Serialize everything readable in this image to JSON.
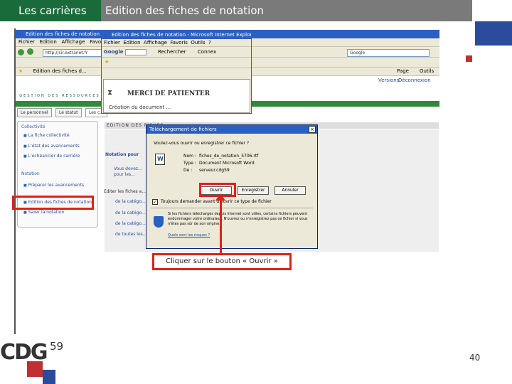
{
  "slide": {
    "section": "Les carrières",
    "title": "Edition des fiches de notation",
    "page_number": "40",
    "logo_text": "CDG",
    "logo_sup": "59"
  },
  "browser_back": {
    "title": "Edition des fiches de notation - Microsoft Internet Explorer",
    "menu": [
      "Fichier",
      "Edition",
      "Affichage",
      "Favoris",
      "Outils",
      "?"
    ],
    "address": "http://cir.extranet.fr",
    "search_placeholder": "Google",
    "tab": "Edition des fiches d...",
    "page_menu": "Page",
    "tools_menu": "Outils",
    "links_right": [
      "Versions",
      "Déconnexion"
    ]
  },
  "browser_front": {
    "title": "Edition des fiches de notation - Microsoft Internet Explorer",
    "menu": [
      "Fichier",
      "Edition",
      "Affichage",
      "Favoris",
      "Outils",
      "?"
    ],
    "google": "Google",
    "favorites": "Rechercher",
    "connect": "Connex",
    "merci": "MERCI DE PATIENTER",
    "status": "Création du document ..."
  },
  "site": {
    "logo": "cir",
    "subtitle": "GESTION DES RESSOURCES",
    "tabs": [
      "Le personnel",
      "Le statut",
      "Les c..."
    ],
    "section_collectivite": "Collectivité",
    "collectivite_items": [
      "La fiche collectivité",
      "L'état des avancements",
      "L'échéancier de carrière"
    ],
    "section_notation": "Notation",
    "notation_items": [
      "Préparer les avancements",
      "Edition des fiches de notation",
      "Saisir la notation"
    ],
    "main_header": "EDITION DES FICHES",
    "notation_pour": "Notation pour",
    "main_lines": [
      "Vous devez...",
      "pour les..."
    ],
    "editer": "Editer les fiches a...",
    "bullets": [
      "de la catégo...",
      "de la catégo...",
      "de la catégo...",
      "de toutes les..."
    ]
  },
  "dialog": {
    "title": "Téléchargement de fichiers",
    "question": "Voulez-vous ouvrir ou enregistrer ce fichier ?",
    "name_label": "Nom :",
    "name_value": "fiches_de_notation_5706.rtf",
    "type_label": "Type :",
    "type_value": "Document Microsoft Word",
    "from_label": "De :",
    "from_value": "serveur.cdg59",
    "btn_open": "Ouvrir",
    "btn_save": "Enregistrer",
    "btn_cancel": "Annuler",
    "checkbox_label": "Toujours demander avant d'ouvrir ce type de fichier",
    "warning": "Si les fichiers téléchargés depuis Internet sont utiles, certains fichiers peuvent endommager votre ordinateur. N'ouvrez ou n'enregistrez pas ce fichier si vous n'êtes pas sûr de son origine.",
    "link": "Quels sont les risques ?"
  },
  "callout": "Cliquer sur le bouton « Ouvrir »"
}
